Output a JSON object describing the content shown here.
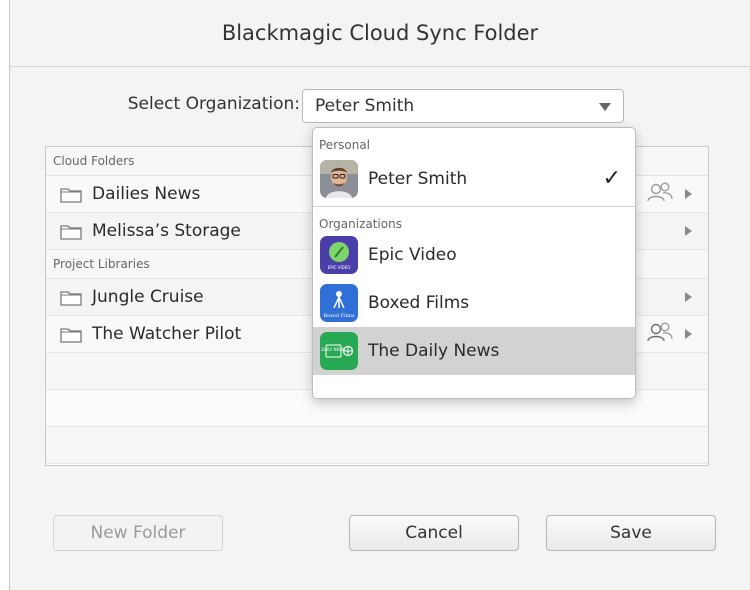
{
  "window": {
    "title": "Blackmagic Cloud Sync Folder"
  },
  "organization": {
    "label": "Select Organization:",
    "selected": "Peter Smith"
  },
  "folders": {
    "cloud_header": "Cloud Folders",
    "cloud_items": [
      "Dailies News",
      "Melissa’s Storage"
    ],
    "library_header": "Project Libraries",
    "library_items": [
      "Jungle Cruise",
      "The Watcher Pilot"
    ]
  },
  "dropdown": {
    "personal_header": "Personal",
    "personal_name": "Peter Smith",
    "orgs_header": "Organizations",
    "orgs": [
      "Epic Video",
      "Boxed Films",
      "The Daily News"
    ],
    "epic_logo_text": "EPIC VIDEO",
    "boxed_logo_text": "Boxed Films",
    "daily_logo_text": "DAILY NEWS"
  },
  "buttons": {
    "new_folder": "New Folder",
    "cancel": "Cancel",
    "save": "Save"
  },
  "colors": {
    "epic_video": "#4a3fa8",
    "boxed_films": "#2f6fd6",
    "daily_news": "#27a852"
  }
}
